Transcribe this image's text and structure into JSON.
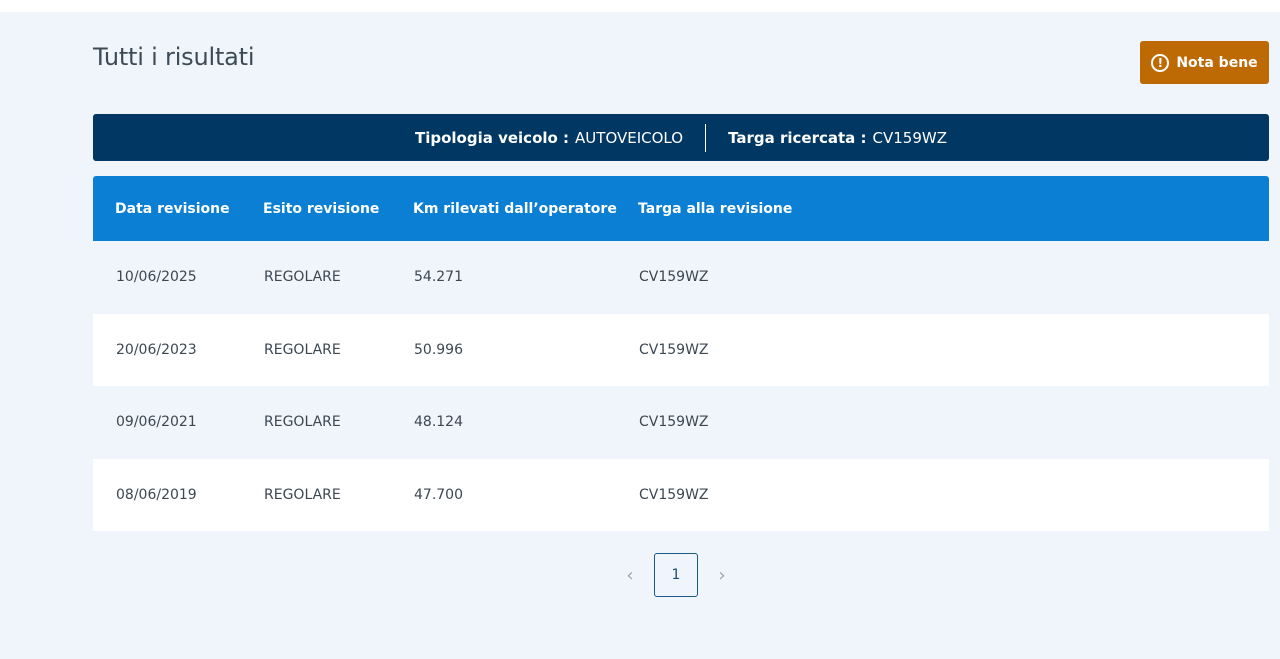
{
  "page": {
    "title": "Tutti i risultati"
  },
  "nota_button": {
    "icon": "exclamation-circle-icon",
    "icon_glyph": "!",
    "label": "Nota bene",
    "color": "#bd6a05"
  },
  "info_bar": {
    "tipologia_label": "Tipologia veicolo :",
    "tipologia_value": "AUTOVEICOLO",
    "targa_label": "Targa ricercata :",
    "targa_value": "CV159WZ",
    "color": "#003763"
  },
  "table": {
    "header_color": "#0b7fd3",
    "headers": [
      "Data revisione",
      "Esito revisione",
      "Km rilevati dall’operatore",
      "Targa alla revisione"
    ],
    "rows": [
      [
        "10/06/2025",
        "REGOLARE",
        "54.271",
        "CV159WZ"
      ],
      [
        "20/06/2023",
        "REGOLARE",
        "50.996",
        "CV159WZ"
      ],
      [
        "09/06/2021",
        "REGOLARE",
        "48.124",
        "CV159WZ"
      ],
      [
        "08/06/2019",
        "REGOLARE",
        "47.700",
        "CV159WZ"
      ]
    ]
  },
  "pagination": {
    "prev_icon": "chevron-left-icon",
    "prev_glyph": "‹",
    "current_page": "1",
    "next_icon": "chevron-right-icon",
    "next_glyph": "›"
  }
}
